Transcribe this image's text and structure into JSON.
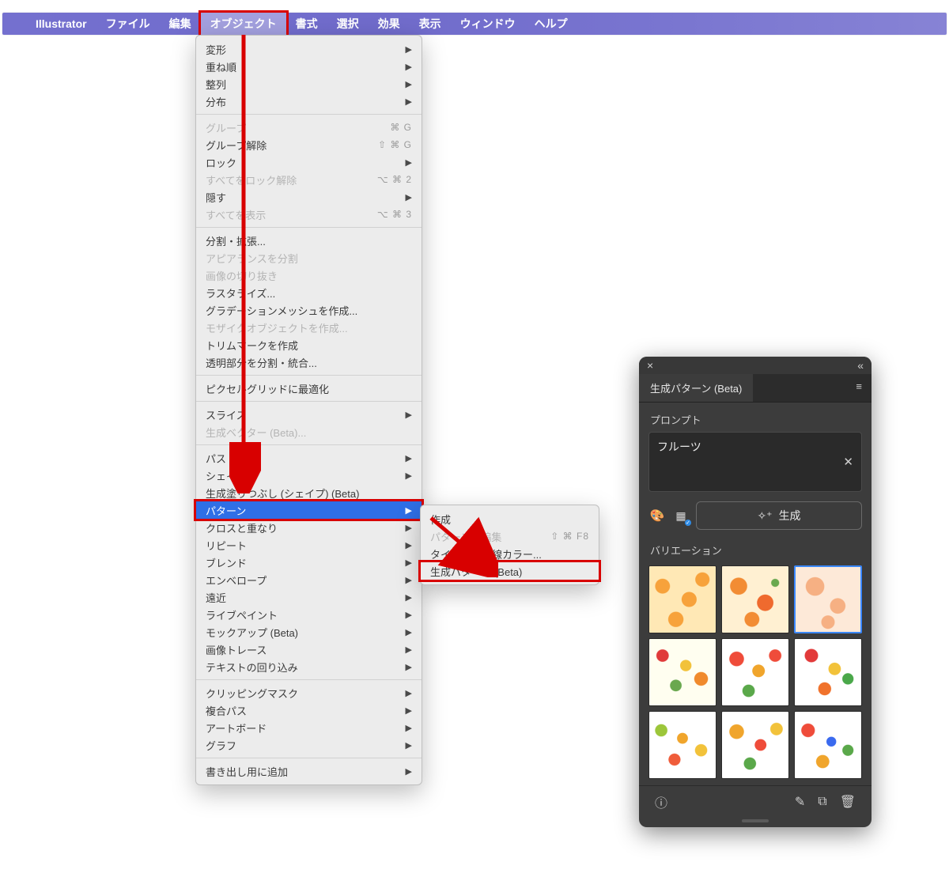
{
  "menubar": {
    "app": "Illustrator",
    "items": [
      "ファイル",
      "編集",
      "オブジェクト",
      "書式",
      "選択",
      "効果",
      "表示",
      "ウィンドウ",
      "ヘルプ"
    ],
    "highlighted_index": 2
  },
  "object_menu": {
    "groups": [
      [
        {
          "label": "変形",
          "submenu": true
        },
        {
          "label": "重ね順",
          "submenu": true
        },
        {
          "label": "整列",
          "submenu": true
        },
        {
          "label": "分布",
          "submenu": true
        }
      ],
      [
        {
          "label": "グループ",
          "shortcut": "⌘ G",
          "disabled": true
        },
        {
          "label": "グループ解除",
          "shortcut": "⇧ ⌘ G"
        },
        {
          "label": "ロック",
          "submenu": true
        },
        {
          "label": "すべてをロック解除",
          "shortcut": "⌥ ⌘ 2",
          "disabled": true
        },
        {
          "label": "隠す",
          "submenu": true
        },
        {
          "label": "すべてを表示",
          "shortcut": "⌥ ⌘ 3",
          "disabled": true
        }
      ],
      [
        {
          "label": "分割・拡張..."
        },
        {
          "label": "アピアランスを分割",
          "disabled": true
        },
        {
          "label": "画像の切り抜き",
          "disabled": true
        },
        {
          "label": "ラスタライズ..."
        },
        {
          "label": "グラデーションメッシュを作成..."
        },
        {
          "label": "モザイクオブジェクトを作成...",
          "disabled": true
        },
        {
          "label": "トリムマークを作成"
        },
        {
          "label": "透明部分を分割・統合..."
        }
      ],
      [
        {
          "label": "ピクセルグリッドに最適化"
        }
      ],
      [
        {
          "label": "スライス",
          "submenu": true
        },
        {
          "label": "生成ベクター (Beta)...",
          "disabled": true
        }
      ],
      [
        {
          "label": "パス",
          "submenu": true
        },
        {
          "label": "シェイプ",
          "submenu": true
        },
        {
          "label": "生成塗りつぶし (シェイプ) (Beta)"
        },
        {
          "label": "パターン",
          "submenu": true,
          "selected": true
        },
        {
          "label": "クロスと重なり",
          "submenu": true
        },
        {
          "label": "リピート",
          "submenu": true
        },
        {
          "label": "ブレンド",
          "submenu": true
        },
        {
          "label": "エンベロープ",
          "submenu": true
        },
        {
          "label": "遠近",
          "submenu": true
        },
        {
          "label": "ライブペイント",
          "submenu": true
        },
        {
          "label": "モックアップ (Beta)",
          "submenu": true
        },
        {
          "label": "画像トレース",
          "submenu": true
        },
        {
          "label": "テキストの回り込み",
          "submenu": true
        }
      ],
      [
        {
          "label": "クリッピングマスク",
          "submenu": true
        },
        {
          "label": "複合パス",
          "submenu": true
        },
        {
          "label": "アートボード",
          "submenu": true
        },
        {
          "label": "グラフ",
          "submenu": true
        }
      ],
      [
        {
          "label": "書き出し用に追加",
          "submenu": true
        }
      ]
    ]
  },
  "pattern_submenu": {
    "items": [
      {
        "label": "作成"
      },
      {
        "label": "パターンを編集",
        "shortcut": "⇧ ⌘ F8",
        "disabled": true
      },
      {
        "label": "タイルの境界線カラー..."
      },
      {
        "label": "生成パターン (Beta)",
        "highlight": true
      }
    ]
  },
  "panel": {
    "tab": "生成パターン (Beta)",
    "prompt_label": "プロンプト",
    "prompt_value": "フルーツ",
    "generate_label": "生成",
    "variations_label": "バリエーション",
    "selected_thumb_index": 2
  }
}
